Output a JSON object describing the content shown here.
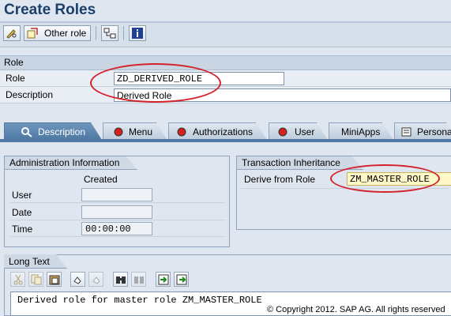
{
  "page": {
    "title": "Create Roles"
  },
  "toolbar": {
    "other_role_label": "Other role"
  },
  "role_block": {
    "header": "Role",
    "role_label": "Role",
    "role_value": "ZD_DERIVED_ROLE",
    "description_label": "Description",
    "description_value": "Derived Role"
  },
  "tabs": [
    {
      "label": "Description",
      "active": true
    },
    {
      "label": "Menu"
    },
    {
      "label": "Authorizations"
    },
    {
      "label": "User"
    },
    {
      "label": "MiniApps"
    },
    {
      "label": "Persona"
    }
  ],
  "admin_info": {
    "header": "Administration Information",
    "column_created": "Created",
    "user_label": "User",
    "user_value": "",
    "date_label": "Date",
    "date_value": "",
    "time_label": "Time",
    "time_value": "00:00:00"
  },
  "transaction_inheritance": {
    "header": "Transaction Inheritance",
    "derive_label": "Derive from Role",
    "derive_value": "ZM_MASTER_ROLE"
  },
  "long_text": {
    "header": "Long Text",
    "content": "Derived role for master role ZM_MASTER_ROLE"
  },
  "footer": {
    "copyright": "© Copyright 2012. SAP AG. All rights reserved"
  },
  "colors": {
    "highlight_ellipse": "#d4212a",
    "active_tab": "#4d79a3",
    "title": "#1b3f6b"
  }
}
